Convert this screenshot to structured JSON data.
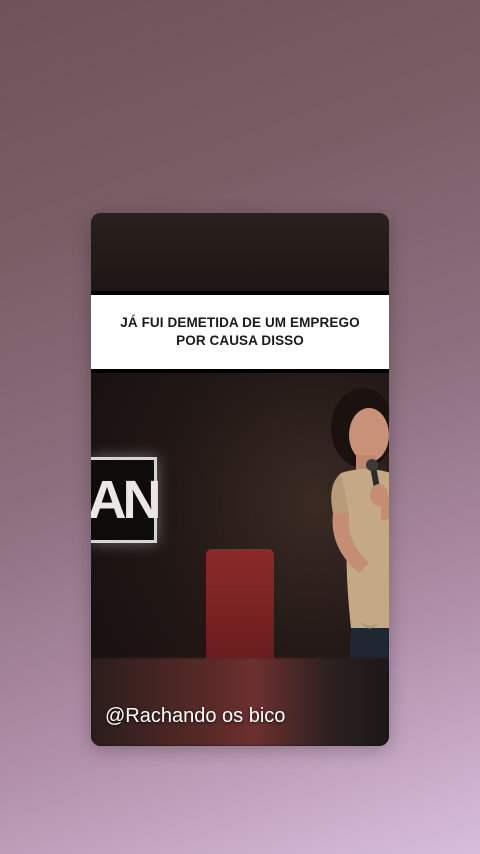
{
  "story": {
    "caption": "JÁ FUI DEMETIDA DE UM EMPREGO POR CAUSA DISSO",
    "sign_text": "AN",
    "watermark": "@Rachando os bico"
  },
  "colors": {
    "caption_background": "#ffffff",
    "caption_text": "#1a1a1a",
    "watermark_text": "#ffffff"
  }
}
